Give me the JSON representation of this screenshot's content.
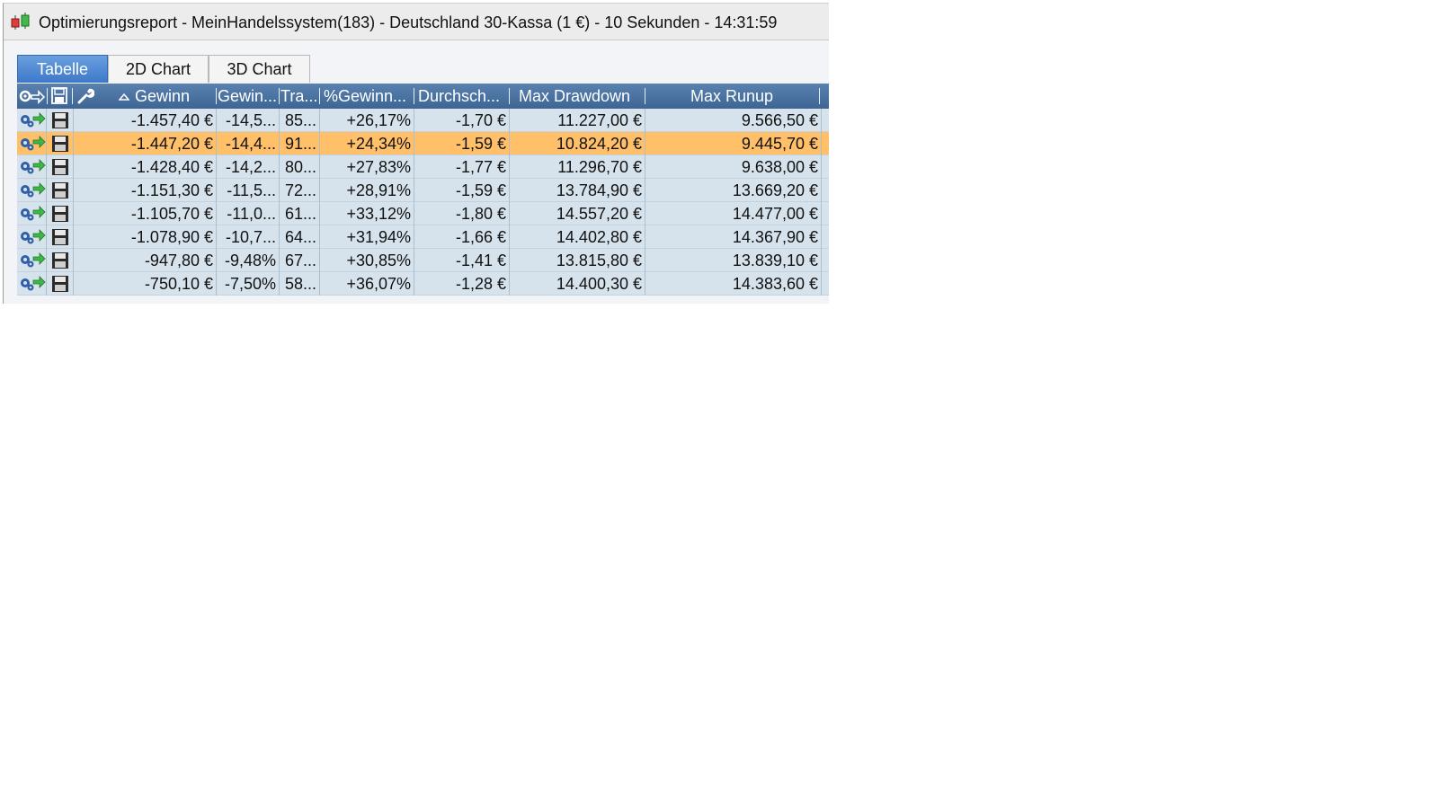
{
  "window": {
    "title": "Optimierungsreport - MeinHandelssystem(183) - Deutschland 30-Kassa (1 €) - 10 Sekunden - 14:31:59",
    "icon": "candlestick-chart-icon"
  },
  "tabs": [
    {
      "label": "Tabelle",
      "active": true
    },
    {
      "label": "2D Chart",
      "active": false
    },
    {
      "label": "3D Chart",
      "active": false
    }
  ],
  "table": {
    "header_icons": [
      "settings-apply-icon",
      "save-icon",
      "wrench-icon"
    ],
    "sort_indicator": "sort-ascending-icon",
    "columns": [
      "Gewinn",
      "Gewin...",
      "Tra...",
      "%Gewinn...",
      "Durchsch...",
      "Max Drawdown",
      "Max Runup"
    ],
    "rows": [
      {
        "gewinn": "-1.457,40 €",
        "gewinn_pct": "-14,5...",
        "trades": "85...",
        "pct_gewinn": "+26,17%",
        "durchschnitt": "-1,70 €",
        "max_drawdown": "11.227,00 €",
        "max_runup": "9.566,50 €",
        "selected": false
      },
      {
        "gewinn": "-1.447,20 €",
        "gewinn_pct": "-14,4...",
        "trades": "91...",
        "pct_gewinn": "+24,34%",
        "durchschnitt": "-1,59 €",
        "max_drawdown": "10.824,20 €",
        "max_runup": "9.445,70 €",
        "selected": true
      },
      {
        "gewinn": "-1.428,40 €",
        "gewinn_pct": "-14,2...",
        "trades": "80...",
        "pct_gewinn": "+27,83%",
        "durchschnitt": "-1,77 €",
        "max_drawdown": "11.296,70 €",
        "max_runup": "9.638,00 €",
        "selected": false
      },
      {
        "gewinn": "-1.151,30 €",
        "gewinn_pct": "-11,5...",
        "trades": "72...",
        "pct_gewinn": "+28,91%",
        "durchschnitt": "-1,59 €",
        "max_drawdown": "13.784,90 €",
        "max_runup": "13.669,20 €",
        "selected": false
      },
      {
        "gewinn": "-1.105,70 €",
        "gewinn_pct": "-11,0...",
        "trades": "61...",
        "pct_gewinn": "+33,12%",
        "durchschnitt": "-1,80 €",
        "max_drawdown": "14.557,20 €",
        "max_runup": "14.477,00 €",
        "selected": false
      },
      {
        "gewinn": "-1.078,90 €",
        "gewinn_pct": "-10,7...",
        "trades": "64...",
        "pct_gewinn": "+31,94%",
        "durchschnitt": "-1,66 €",
        "max_drawdown": "14.402,80 €",
        "max_runup": "14.367,90 €",
        "selected": false
      },
      {
        "gewinn": "-947,80 €",
        "gewinn_pct": "-9,48%",
        "trades": "67...",
        "pct_gewinn": "+30,85%",
        "durchschnitt": "-1,41 €",
        "max_drawdown": "13.815,80 €",
        "max_runup": "13.839,10 €",
        "selected": false
      },
      {
        "gewinn": "-750,10 €",
        "gewinn_pct": "-7,50%",
        "trades": "58...",
        "pct_gewinn": "+36,07%",
        "durchschnitt": "-1,28 €",
        "max_drawdown": "14.400,30 €",
        "max_runup": "14.383,60 €",
        "selected": false
      }
    ],
    "row_icons": [
      "apply-settings-icon",
      "save-icon"
    ]
  },
  "colors": {
    "header_bg": "#3e6594",
    "row_bg": "#d6e3ec",
    "selected_row_bg": "#ffc069",
    "active_tab_bg": "#3d78c9"
  }
}
